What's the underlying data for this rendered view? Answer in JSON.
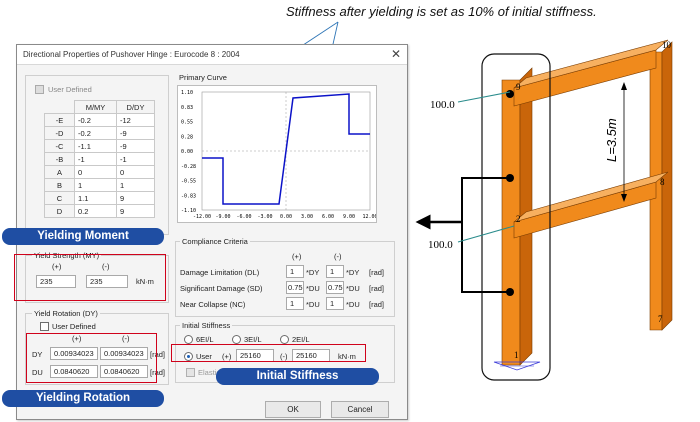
{
  "annotation_top": "Stiffness after yielding is set as 10% of initial stiffness.",
  "dialog": {
    "title": "Directional Properties of Pushover Hinge : Eurocode 8 : 2004",
    "user_defined_label": "User Defined",
    "table_headers": [
      "M/MY",
      "D/DY"
    ],
    "rows": [
      {
        "label": "-E",
        "m": "-0.2",
        "d": "-12"
      },
      {
        "label": "-D",
        "m": "-0.2",
        "d": "-9"
      },
      {
        "label": "-C",
        "m": "-1.1",
        "d": "-9"
      },
      {
        "label": "-B",
        "m": "-1",
        "d": "-1"
      },
      {
        "label": "A",
        "m": "0",
        "d": "0"
      },
      {
        "label": "B",
        "m": "1",
        "d": "1"
      },
      {
        "label": "C",
        "m": "1.1",
        "d": "9"
      },
      {
        "label": "D",
        "m": "0.2",
        "d": "9"
      }
    ],
    "yield_strength": {
      "title": "Yield Strength (MY)",
      "plus": "(+)",
      "minus": "(-)",
      "v_plus": "235",
      "v_minus": "235",
      "unit": "kN·m"
    },
    "yield_rotation": {
      "title": "Yield Rotation (DY)",
      "user_defined": "User Defined",
      "plus": "(+)",
      "minus": "(-)",
      "dy_label": "DY",
      "du_label": "DU",
      "dy_plus": "0.00934023",
      "dy_minus": "0.00934023",
      "du_plus": "0.0840620",
      "du_minus": "0.0840620",
      "unit": "[rad]"
    },
    "primary_curve": {
      "title": "Primary Curve",
      "y_ticks": [
        "1.10",
        "0.83",
        "0.55",
        "0.28",
        "0.00",
        "-0.28",
        "-0.55",
        "-0.83",
        "-1.10"
      ],
      "x_ticks": [
        "-12.00",
        "-9.00",
        "-6.00",
        "-3.00",
        "0.00",
        "3.00",
        "6.00",
        "9.00",
        "12.00"
      ]
    },
    "compliance": {
      "title": "Compliance Criteria",
      "plus": "(+)",
      "minus": "(-)",
      "rows": [
        {
          "label": "Damage Limitation (DL)",
          "plus": "1",
          "plus_unit": "*DY",
          "minus": "1",
          "minus_unit": "*DY",
          "unit": "[rad]"
        },
        {
          "label": "Significant Damage (SD)",
          "plus": "0.75",
          "plus_unit": "*DU",
          "minus": "0.75",
          "minus_unit": "*DU",
          "unit": "[rad]"
        },
        {
          "label": "Near Collapse (NC)",
          "plus": "1",
          "plus_unit": "*DU",
          "minus": "1",
          "minus_unit": "*DU",
          "unit": "[rad]"
        }
      ]
    },
    "initial_stiffness": {
      "title": "Initial Stiffness",
      "opt1": "6EI/L",
      "opt2": "3EI/L",
      "opt3": "2EI/L",
      "user": "User",
      "plus": "(+)",
      "v_plus": "25160",
      "minus": "(-)",
      "v_minus": "25160",
      "unit": "kN·m",
      "elastic": "Elastic Stiffness"
    },
    "ok": "OK",
    "cancel": "Cancel"
  },
  "badges": {
    "yielding_moment": "Yielding Moment",
    "yielding_rotation": "Yielding Rotation",
    "initial_stiffness": "Initial Stiffness"
  },
  "frame": {
    "node_9": "9",
    "node_10": "10",
    "node_8": "8",
    "node_2": "2",
    "node_7": "7",
    "node_1": "1",
    "load_top": "100.0",
    "load_mid": "100.0",
    "height": "L=3.5m"
  },
  "colors": {
    "frame": "#f08a1c",
    "frame_dark": "#c9650a",
    "badge": "#1f4ea3",
    "highlight": "#d0021b",
    "curve": "#0b12c8"
  }
}
